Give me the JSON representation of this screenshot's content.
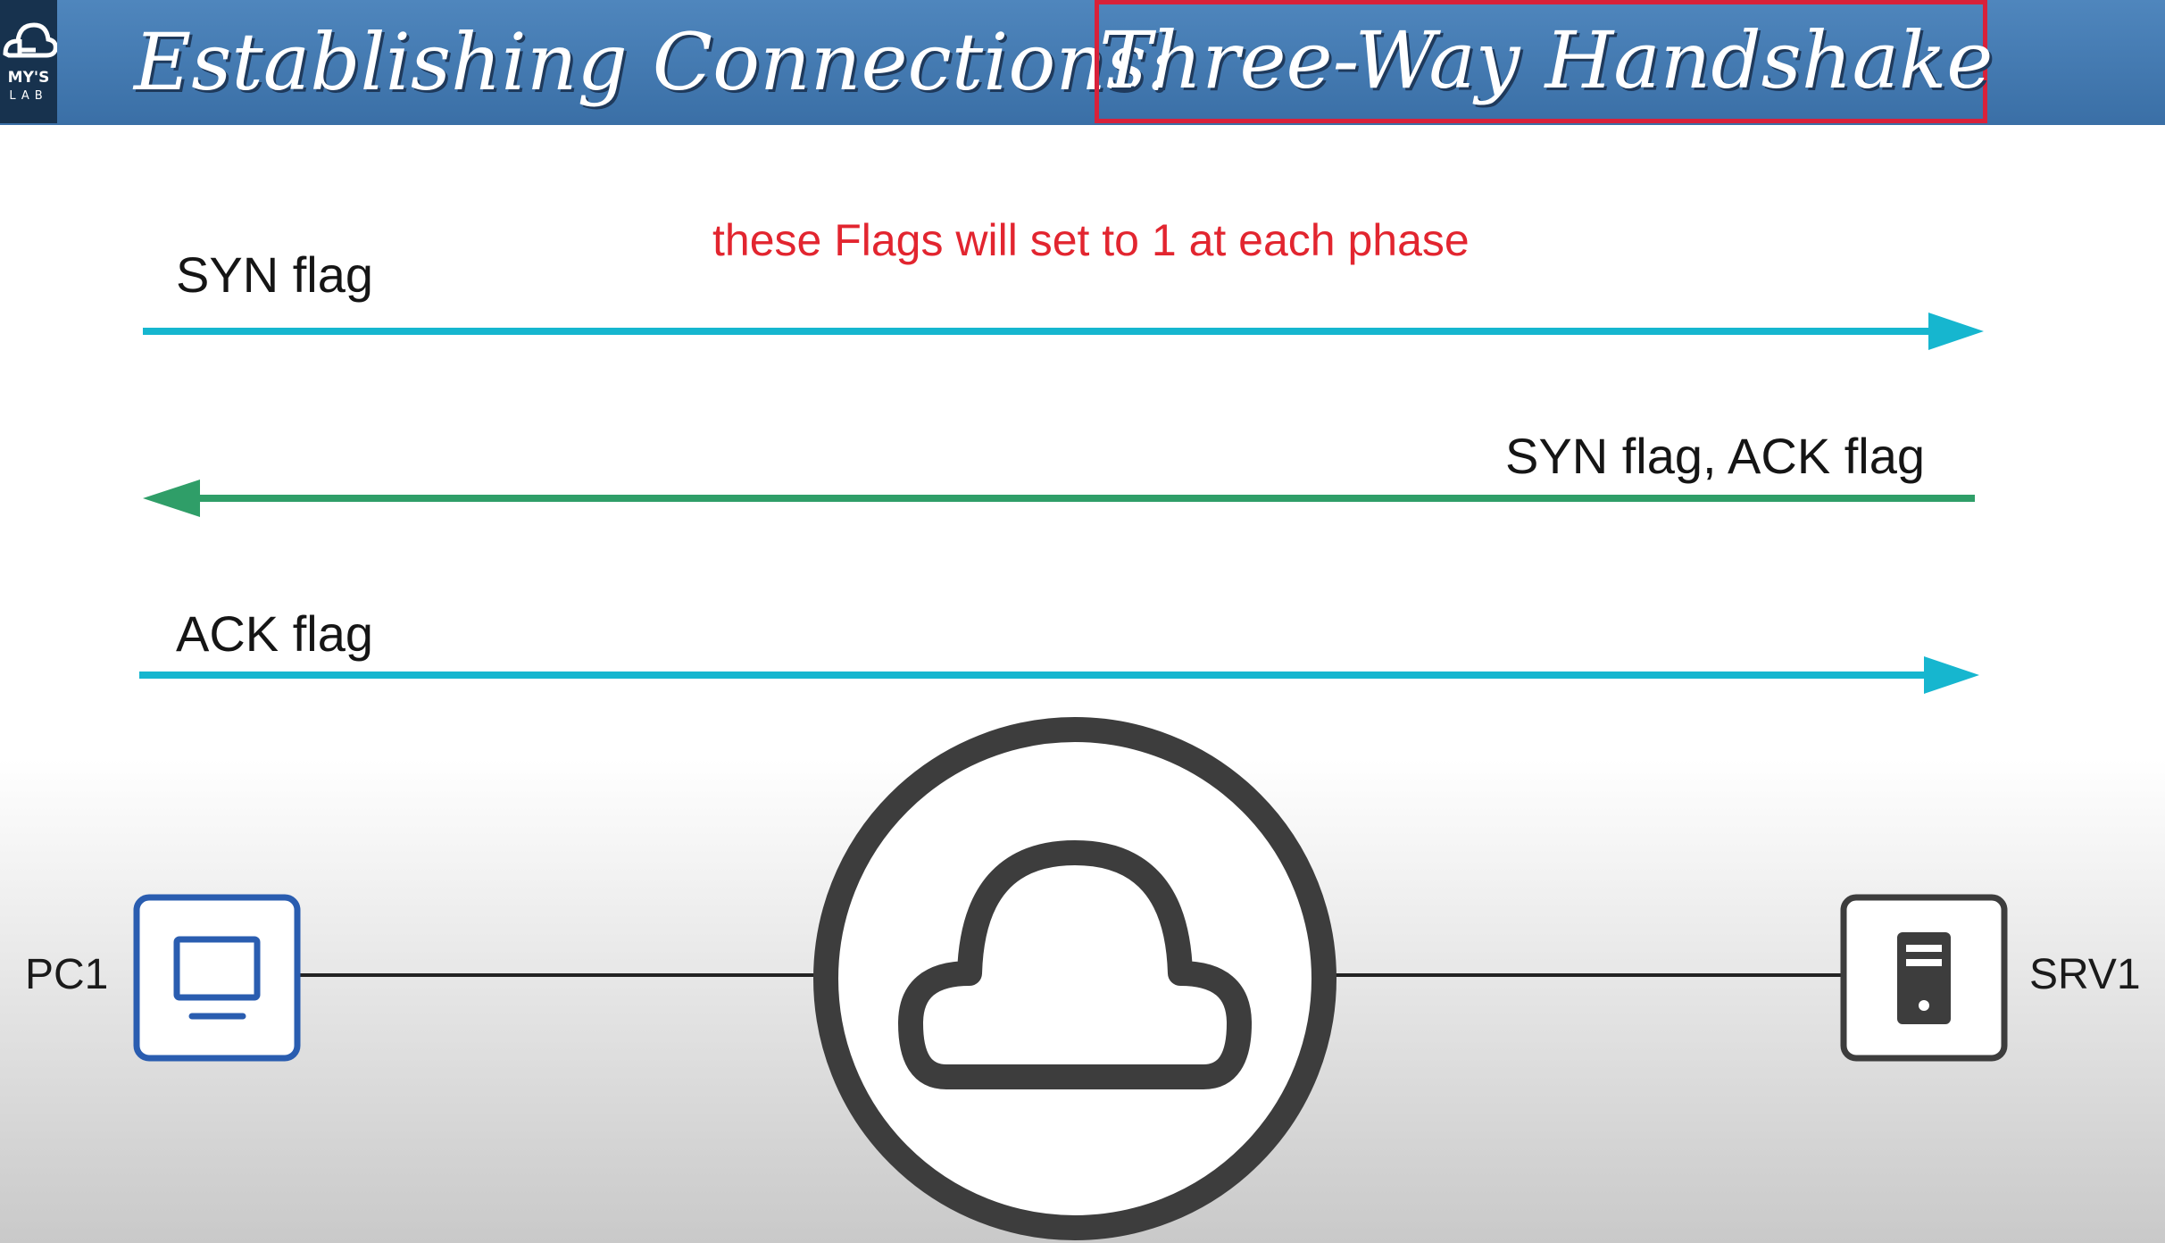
{
  "header": {
    "logo_text": "MY'S",
    "logo_sub": "LAB",
    "title_prefix": "Establishing Connections:",
    "title_highlight": "Three-Way Handshake"
  },
  "annotation": "these Flags will set to 1 at each phase",
  "messages": [
    {
      "label": "SYN flag",
      "direction": "right",
      "color": "#16b6cf"
    },
    {
      "label": "SYN flag, ACK flag",
      "direction": "left",
      "color": "#2f9e68"
    },
    {
      "label": "ACK flag",
      "direction": "right",
      "color": "#16b6cf"
    }
  ],
  "nodes": {
    "client": {
      "label": "PC1",
      "icon": "desktop-computer-icon",
      "color": "#2a5db0"
    },
    "network": {
      "icon": "cloud-icon",
      "color": "#3d3d3d"
    },
    "server": {
      "label": "SRV1",
      "icon": "server-icon",
      "color": "#3d3d3d"
    }
  },
  "colors": {
    "header": "#3f75ad",
    "highlight_border": "#d8213a",
    "annotation": "#e2252f"
  }
}
